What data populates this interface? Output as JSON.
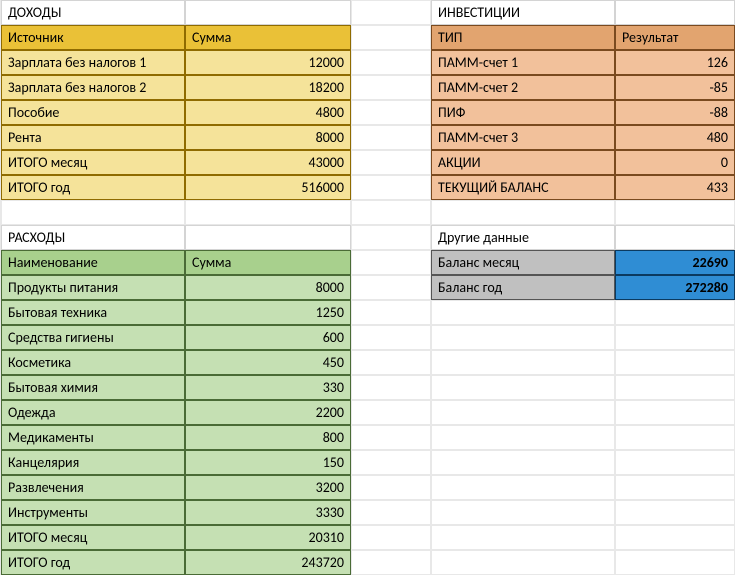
{
  "income": {
    "title": "ДОХОДЫ",
    "headers": {
      "source": "Источник",
      "amount": "Сумма"
    },
    "rows": [
      {
        "source": "Зарплата без налогов 1",
        "amount": "12000"
      },
      {
        "source": "Зарплата без налогов 2",
        "amount": "18200"
      },
      {
        "source": "Пособие",
        "amount": "4800"
      },
      {
        "source": "Рента",
        "amount": "8000"
      },
      {
        "source": "ИТОГО месяц",
        "amount": "43000"
      },
      {
        "source": "ИТОГО год",
        "amount": "516000"
      }
    ]
  },
  "investments": {
    "title": "ИНВЕСТИЦИИ",
    "headers": {
      "type": "ТИП",
      "result": "Результат"
    },
    "rows": [
      {
        "type": "ПАММ-счет 1",
        "result": "126"
      },
      {
        "type": "ПАММ-счет 2",
        "result": "-85"
      },
      {
        "type": "ПИФ",
        "result": "-88"
      },
      {
        "type": "ПАММ-счет 3",
        "result": "480"
      },
      {
        "type": "АКЦИИ",
        "result": "0"
      },
      {
        "type": "ТЕКУЩИЙ БАЛАНС",
        "result": "433"
      }
    ]
  },
  "expenses": {
    "title": "РАСХОДЫ",
    "headers": {
      "name": "Наименование",
      "amount": "Сумма"
    },
    "rows": [
      {
        "name": "Продукты питания",
        "amount": "8000"
      },
      {
        "name": "Бытовая техника",
        "amount": "1250"
      },
      {
        "name": "Средства гигиены",
        "amount": "600"
      },
      {
        "name": "Косметика",
        "amount": "450"
      },
      {
        "name": "Бытовая химия",
        "amount": "330"
      },
      {
        "name": "Одежда",
        "amount": "2200"
      },
      {
        "name": "Медикаменты",
        "amount": "800"
      },
      {
        "name": "Канцелярия",
        "amount": "150"
      },
      {
        "name": "Развлечения",
        "amount": "3200"
      },
      {
        "name": "Инструменты",
        "amount": "3330"
      },
      {
        "name": "ИТОГО месяц",
        "amount": "20310"
      },
      {
        "name": "ИТОГО год",
        "amount": "243720"
      }
    ]
  },
  "other": {
    "title": "Другие данные",
    "rows": [
      {
        "label": "Баланс месяц",
        "value": "22690"
      },
      {
        "label": "Баланс год",
        "value": "272280"
      }
    ]
  }
}
